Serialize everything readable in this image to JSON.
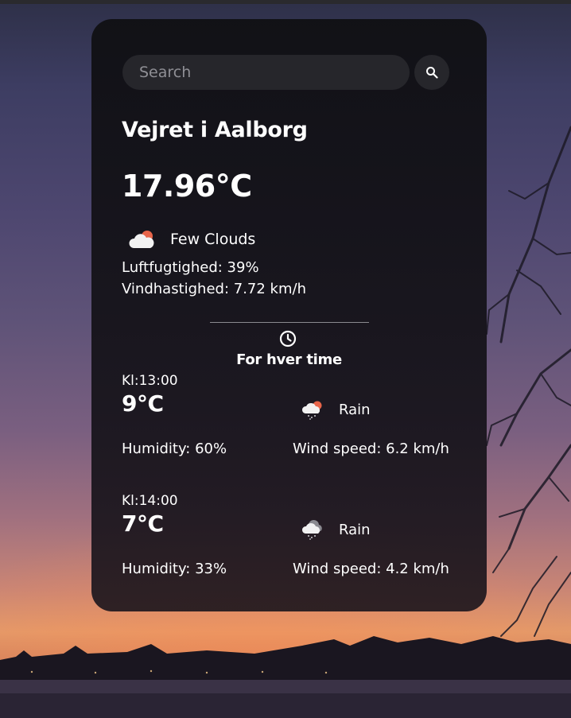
{
  "search": {
    "placeholder": "Search"
  },
  "icons": {
    "search_button": "search-icon",
    "current_condition": "few-clouds-icon",
    "hourly_header": "clock-icon",
    "rain": "rain-cloud-icon"
  },
  "current": {
    "title": "Vejret i Aalborg",
    "temperature": "17.96°C",
    "condition": "Few Clouds",
    "humidity": "Luftfugtighed: 39%",
    "wind": "Vindhastighed: 7.72 km/h"
  },
  "hourly": {
    "title": "For hver time",
    "items": [
      {
        "time": "Kl:13:00",
        "temp": "9°C",
        "condition": "Rain",
        "humidity": "Humidity: 60%",
        "wind": "Wind speed: 6.2 km/h"
      },
      {
        "time": "Kl:14:00",
        "temp": "7°C",
        "condition": "Rain",
        "humidity": "Humidity: 33%",
        "wind": "Wind speed: 4.2 km/h"
      }
    ]
  },
  "colors": {
    "card_background": "#121216",
    "input_background": "#26262b",
    "sun_orange": "#e8654a",
    "text": "#ffffff"
  }
}
